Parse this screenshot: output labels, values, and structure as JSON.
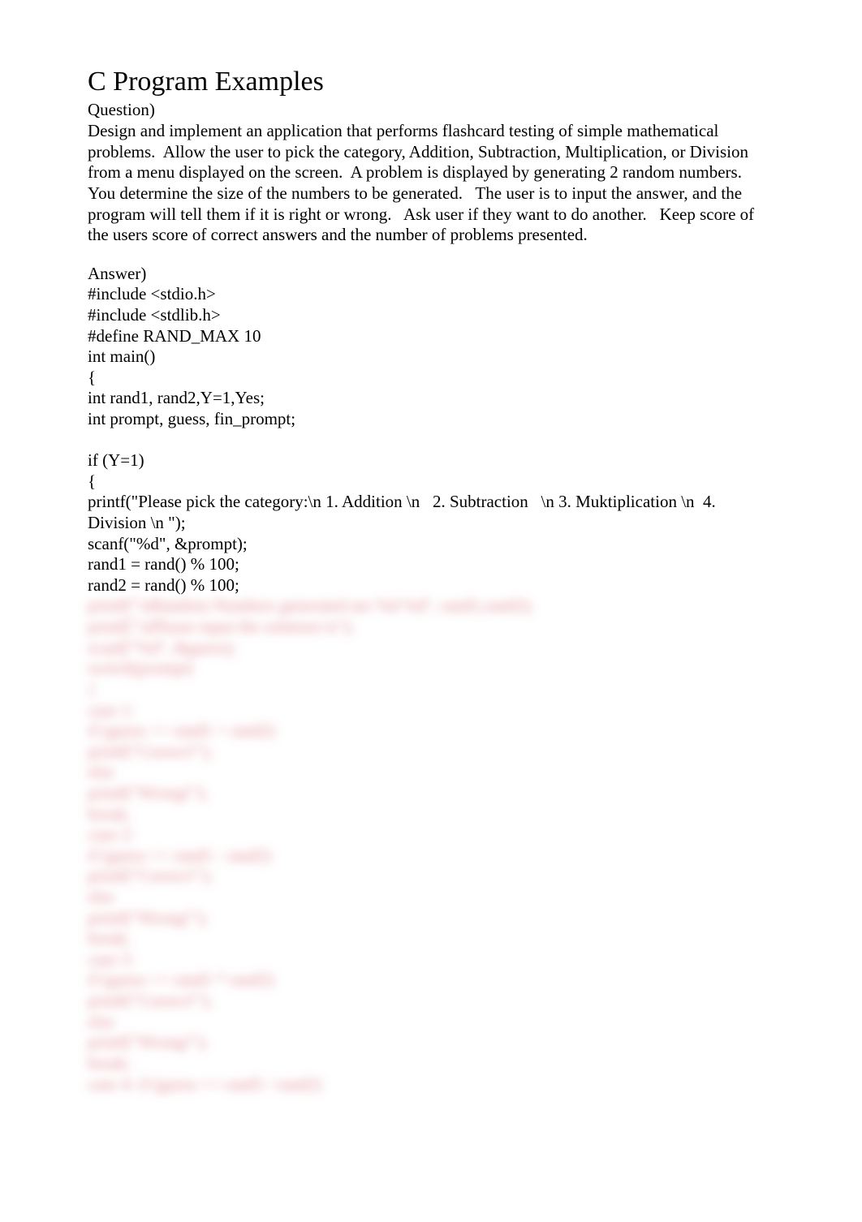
{
  "title": "C Program Examples",
  "question_label": "Question)",
  "question_body": "Design and implement an application that performs flashcard testing of simple mathematical problems.  Allow the user to pick the category, Addition, Subtraction, Multiplication, or Division from a menu displayed on the screen.  A problem is displayed by generating 2 random numbers.  You determine the size of the numbers to be generated.   The user is to input the answer, and the program will tell them if it is right or wrong.   Ask user if they want to do another.   Keep score of the users score of correct answers and the number of problems presented.",
  "answer_label": "Answer)",
  "code_visible": "#include <stdio.h>\n#include <stdlib.h>\n#define RAND_MAX 10\nint main()\n{\nint rand1, rand2,Y=1,Yes;\nint prompt, guess, fin_prompt;\n\nif (Y=1)\n{\nprintf(\"Please pick the category:\\n 1. Addition \\n   2. Subtraction   \\n 3. Muktiplication \\n  4. Division \\n \");\nscanf(\"%d\", &prompt);\nrand1 = rand() % 100;\nrand2 = rand() % 100;",
  "code_blurred": "printf(\"\\nRandom Numbers generated are %d %d\", rand1,rand2);\nprintf(\"\\nPlease input the solution:\\n\");\nscanf(\"%d\", &guess);\nswitch(prompt)\n{\ncase 1:\nif (guess == rand1 + rand2)\nprintf(\"Correct!\");\nelse\nprintf(\"Wrong!\");\nbreak;\ncase 2:\nif (guess == rand1 - rand2)\nprintf(\"Correct!\");\nelse\nprintf(\"Wrong!\");\nbreak;\ncase 3:\nif (guess == rand1 * rand2)\nprintf(\"Correct!\");\nelse\nprintf(\"Wrong!\");\nbreak;\ncase 4: if (guess == rand1 / rand2)"
}
